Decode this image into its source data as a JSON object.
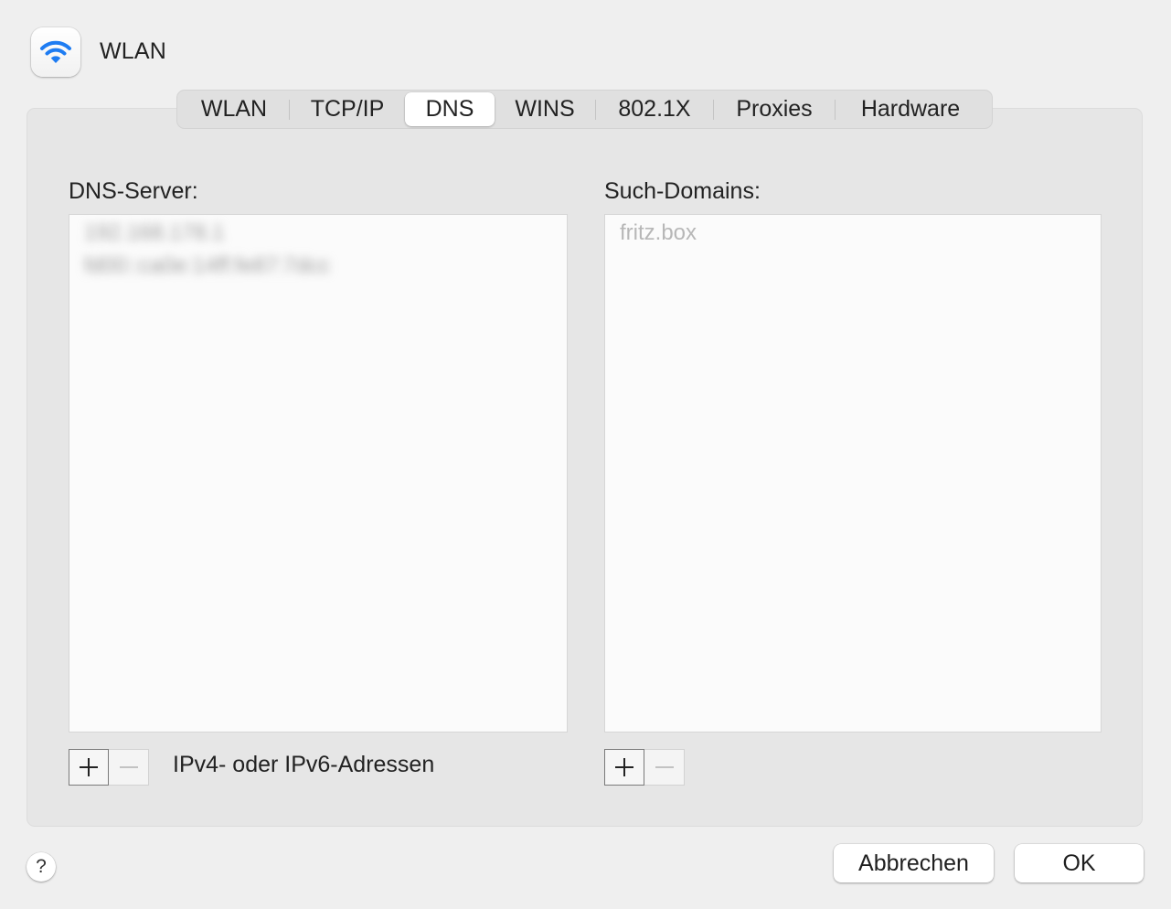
{
  "header": {
    "title": "WLAN",
    "icon": "wifi-icon",
    "accent_color": "#1e7cf2"
  },
  "tabs": [
    {
      "label": "WLAN"
    },
    {
      "label": "TCP/IP"
    },
    {
      "label": "DNS",
      "active": true
    },
    {
      "label": "WINS"
    },
    {
      "label": "802.1X"
    },
    {
      "label": "Proxies"
    },
    {
      "label": "Hardware"
    }
  ],
  "dns": {
    "label": "DNS-Server:",
    "servers": [
      "192.168.178.1",
      "fd00::ca0e:14ff:fe87:7dcc"
    ],
    "hint": "IPv4- oder IPv6-Adressen"
  },
  "search": {
    "label": "Such-Domains:",
    "domains": [
      "fritz.box"
    ]
  },
  "controls": {
    "add_symbol": "+",
    "remove_symbol": "−"
  },
  "footer": {
    "help": "?",
    "cancel": "Abbrechen",
    "ok": "OK"
  }
}
